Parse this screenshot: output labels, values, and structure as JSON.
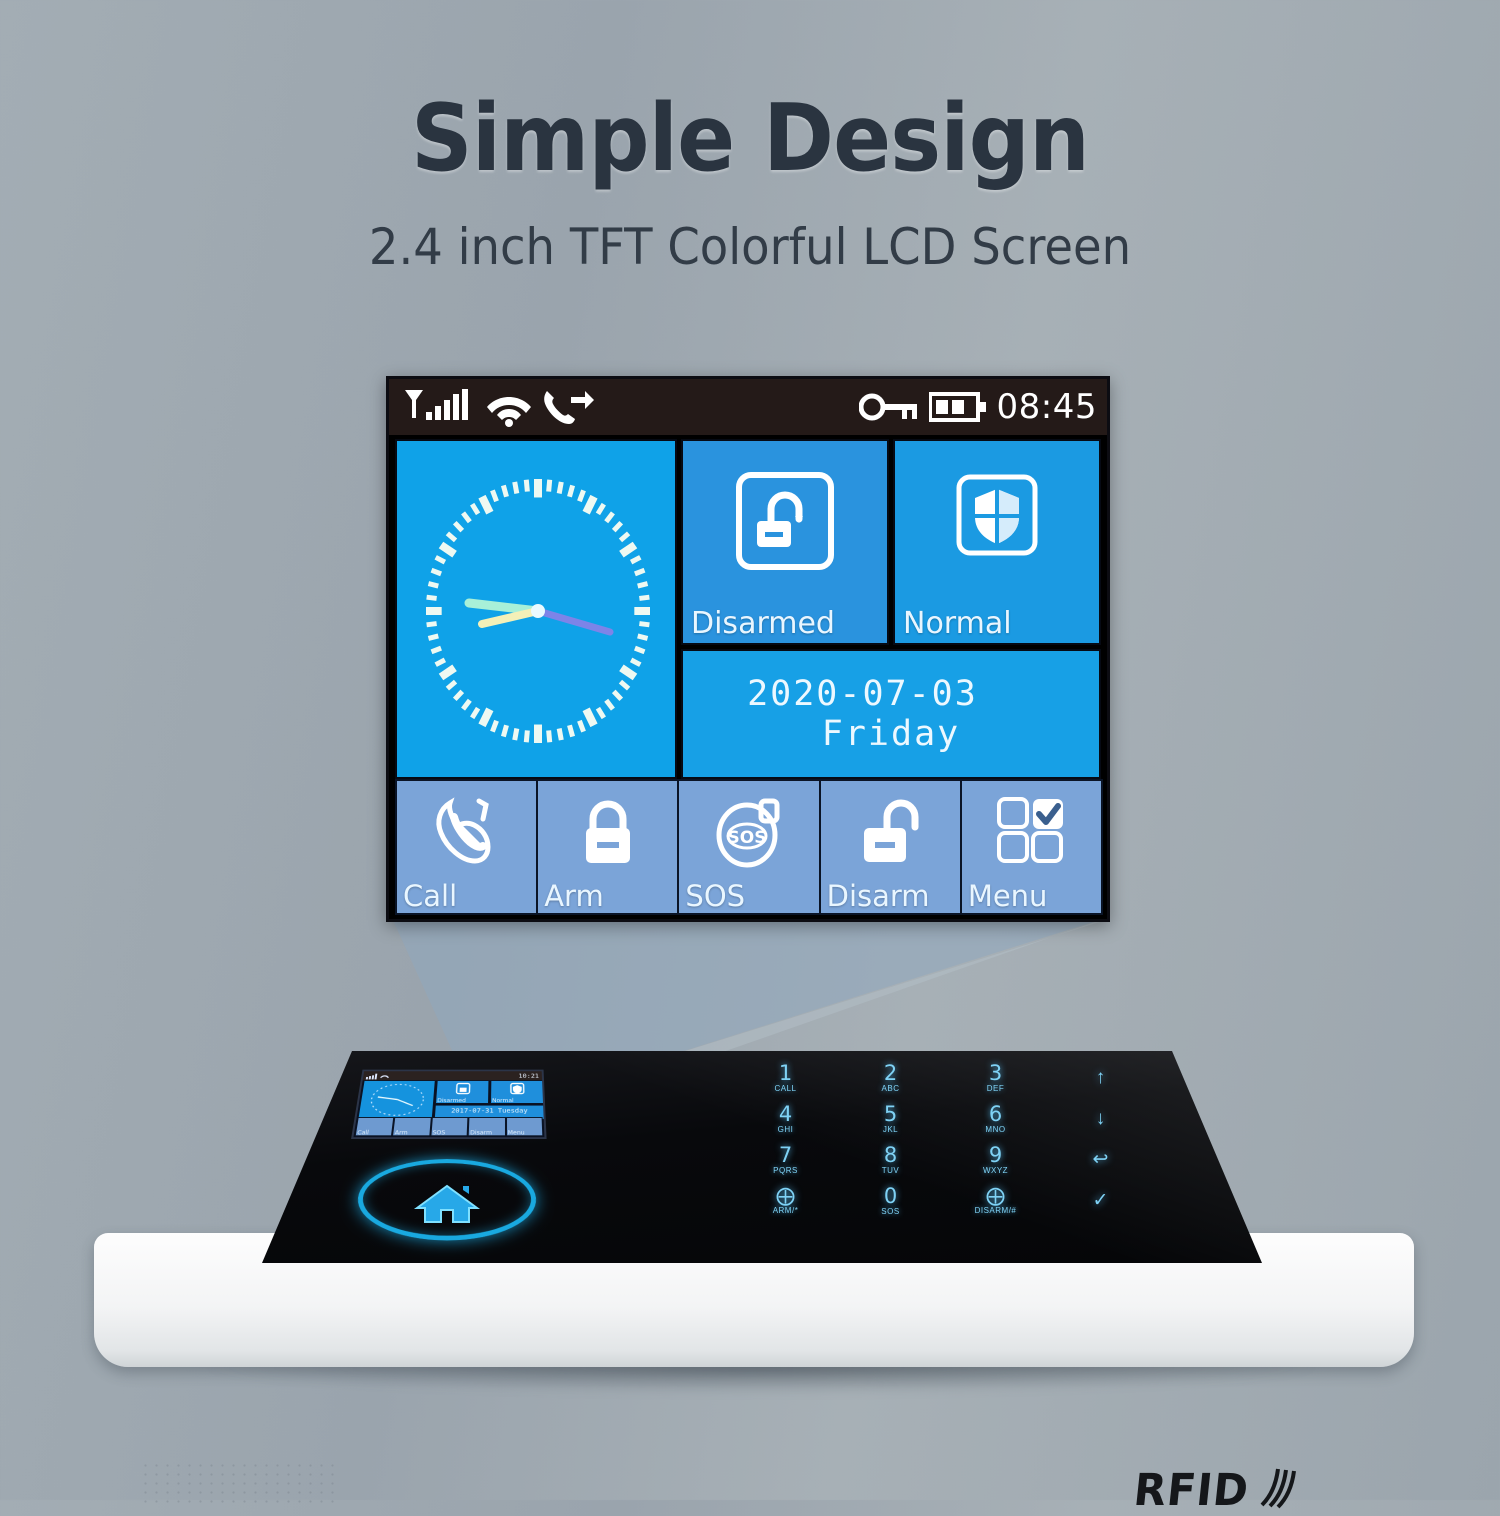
{
  "header": {
    "title": "Simple Design",
    "subtitle": "2.4 inch TFT Colorful LCD Screen"
  },
  "colors": {
    "background": "#9ea8b0",
    "headline": "#2a3440",
    "tile_primary": "#1b9ae2",
    "tile_secondary": "#7ba4d8",
    "statusbar": "#241a18",
    "keypad_glow": "#7fd2f5",
    "home_ring": "#19a9e0"
  },
  "lcd": {
    "statusbar": {
      "icons_left": [
        "signal-bars-icon",
        "wifi-icon",
        "call-forward-icon"
      ],
      "icons_right": [
        "key-icon",
        "battery-icon"
      ],
      "signal_bars": 5,
      "battery_level": 2,
      "time": "08:45"
    },
    "clock": {
      "icon": "analog-clock-icon",
      "hour_hand_deg": 255,
      "minute_hand_deg": 273,
      "second_hand_deg": 110,
      "tick_count": 60
    },
    "status_tiles": [
      {
        "label": "Disarmed",
        "icon": "unlock-square-icon"
      },
      {
        "label": "Normal",
        "icon": "shield-square-icon"
      }
    ],
    "date_tile": {
      "date": "2020-07-03",
      "weekday": "Friday"
    },
    "bottom_buttons": [
      {
        "label": "Call",
        "icon": "phone-call-icon"
      },
      {
        "label": "Arm",
        "icon": "padlock-closed-icon"
      },
      {
        "label": "SOS",
        "icon": "sos-icon"
      },
      {
        "label": "Disarm",
        "icon": "padlock-open-icon"
      },
      {
        "label": "Menu",
        "icon": "grid-check-icon"
      }
    ]
  },
  "device": {
    "mini_lcd": {
      "time": "10:21",
      "status_tiles": [
        {
          "label": "Disarmed"
        },
        {
          "label": "Normal"
        }
      ],
      "date": "2017-07-31  Tuesday",
      "bottom_buttons": [
        {
          "label": "Call"
        },
        {
          "label": "Arm"
        },
        {
          "label": "SOS"
        },
        {
          "label": "Disarm"
        },
        {
          "label": "Menu"
        }
      ]
    },
    "home_button": {
      "icon": "home-icon"
    },
    "rfid_logo": {
      "text": "RFID",
      "icon": "rfid-wave-icon"
    },
    "speaker": {
      "icon": "speaker-grille-icon"
    },
    "keypad": [
      {
        "num": "1",
        "sub": "CALL"
      },
      {
        "num": "2",
        "sub": "ABC"
      },
      {
        "num": "3",
        "sub": "DEF"
      },
      {
        "num": "",
        "sub": "",
        "icon": "arrow-up-icon",
        "glyph": "↑"
      },
      {
        "num": "4",
        "sub": "GHI"
      },
      {
        "num": "5",
        "sub": "JKL"
      },
      {
        "num": "6",
        "sub": "MNO"
      },
      {
        "num": "",
        "sub": "",
        "icon": "arrow-down-icon",
        "glyph": "↓"
      },
      {
        "num": "7",
        "sub": "PQRS"
      },
      {
        "num": "8",
        "sub": "TUV"
      },
      {
        "num": "9",
        "sub": "WXYZ"
      },
      {
        "num": "",
        "sub": "",
        "icon": "back-arrow-icon",
        "glyph": "↩"
      },
      {
        "num": "",
        "sub": "ARM/*",
        "icon": "padlock-closed-icon",
        "glyph": "⨁"
      },
      {
        "num": "0",
        "sub": "SOS"
      },
      {
        "num": "",
        "sub": "DISARM/#",
        "icon": "padlock-open-icon",
        "glyph": "⨁"
      },
      {
        "num": "",
        "sub": "",
        "icon": "check-icon",
        "glyph": "✓"
      }
    ]
  }
}
